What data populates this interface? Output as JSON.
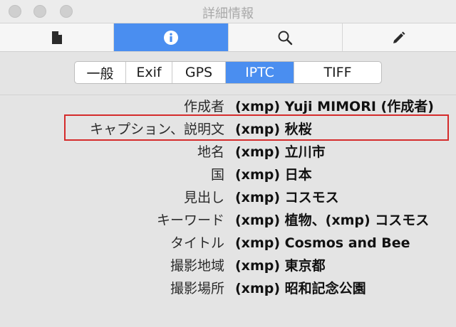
{
  "window": {
    "title": "詳細情報"
  },
  "toolbar": {
    "buttons": [
      {
        "icon": "document-icon",
        "active": false
      },
      {
        "icon": "info-icon",
        "active": true
      },
      {
        "icon": "search-icon",
        "active": false
      },
      {
        "icon": "pencil-icon",
        "active": false
      }
    ]
  },
  "tabs": {
    "items": [
      "一般",
      "Exif",
      "GPS",
      "IPTC",
      "TIFF"
    ],
    "selected": "IPTC"
  },
  "metadata": {
    "rows": [
      {
        "label": "作成者",
        "value": "(xmp) Yuji MIMORI (作成者)"
      },
      {
        "label": "キャプション、説明文",
        "value": "(xmp) 秋桜"
      },
      {
        "label": "地名",
        "value": "(xmp) 立川市"
      },
      {
        "label": "国",
        "value": "(xmp) 日本"
      },
      {
        "label": "見出し",
        "value": "(xmp) コスモス"
      },
      {
        "label": "キーワード",
        "value": "(xmp) 植物、(xmp) コスモス"
      },
      {
        "label": "タイトル",
        "value": "(xmp) Cosmos and Bee"
      },
      {
        "label": "撮影地域",
        "value": "(xmp) 東京都"
      },
      {
        "label": "撮影場所",
        "value": "(xmp) 昭和記念公園"
      }
    ]
  },
  "colors": {
    "accent": "#4a8ef0",
    "highlight_border": "#d52b2b"
  }
}
